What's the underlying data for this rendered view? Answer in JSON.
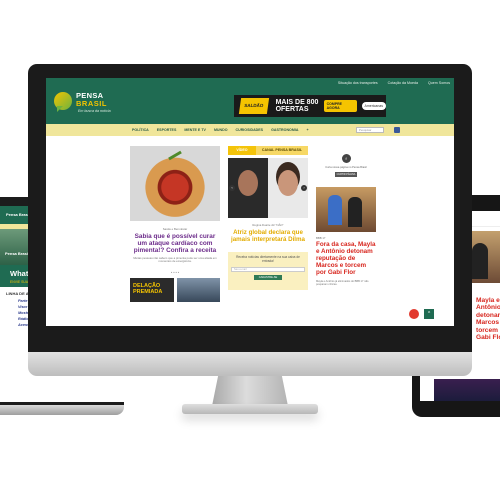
{
  "site": {
    "topbar": [
      "Situação dos transportes",
      "Cotação da Moeda",
      "Quem Somos"
    ],
    "logo_line1": "PENSA",
    "logo_line2": "BRASIL",
    "logo_tagline": "Em busca da notícia",
    "banner": {
      "brand": "SALDÃO",
      "offer": "MAIS DE 800 OFERTAS",
      "cta": "COMPRE AGORA",
      "partner": "Americanas"
    },
    "nav": [
      "POLÍTICA",
      "ESPORTES",
      "MENTE E TV",
      "MUNDO",
      "CURIOSIDADES",
      "GASTRONOMIA",
      "+"
    ],
    "search_placeholder": "Pesquisar"
  },
  "left_card": {
    "credit": "Saúde e Bem-Estar",
    "title": "Sabia que é possível curar um ataque cardíaco com pimenta!? Confira a receita",
    "excerpt": "Muitas pessoas não sabem que a pimenta pode ser uma aliada em momentos de emergência.",
    "pager": "● ● ● ●",
    "mini1": "DELAÇÃO PREMIADA"
  },
  "mid_card": {
    "tab_a": "VÍDEO",
    "tab_b": "CANAL PENSA BRASIL",
    "arrow_left": "‹",
    "arrow_right": "›",
    "credit": "Regina Duarte diz \"NÃO\"",
    "title": "Atriz global declara que jamais interpretará Dilma",
    "newsletter_text": "Receba notícias diretamente na sua caixa de entrada!",
    "newsletter_placeholder": "Seu e-mail",
    "newsletter_btn": "CADASTRE-SE"
  },
  "right_card": {
    "badge": "f",
    "fb_text": "Curta nossa página no Pensa Brasil",
    "fb_btn": "CURTIR PÁGINA",
    "credit": "BBB 17",
    "title": "Fora da casa, Mayla e Antônio detonam reputação de Marcos e torcem por Gabi Flor",
    "excerpt": "Mayla e Antônio já eliminados do BBB 17 não pouparam críticas."
  },
  "up_arrow": "^",
  "laptop": {
    "header": "Pensa Brasil",
    "brand": "Pensa Brasil",
    "whats": "WhatsApp",
    "whats_sub": "ENVIE SUA NOTÍCIA",
    "list_title": "LINHA DE ACÚSTICA",
    "items": [
      "Parte Acústica",
      "Visor Acústica",
      "Mostra Acústica",
      "Rádio Acústica",
      "Acessórios Acústica"
    ]
  },
  "tablet": {
    "header": "Pensa Brasil",
    "title": "Mayla e Antônio detonam Marcos e torcem por Gabi Flor"
  }
}
